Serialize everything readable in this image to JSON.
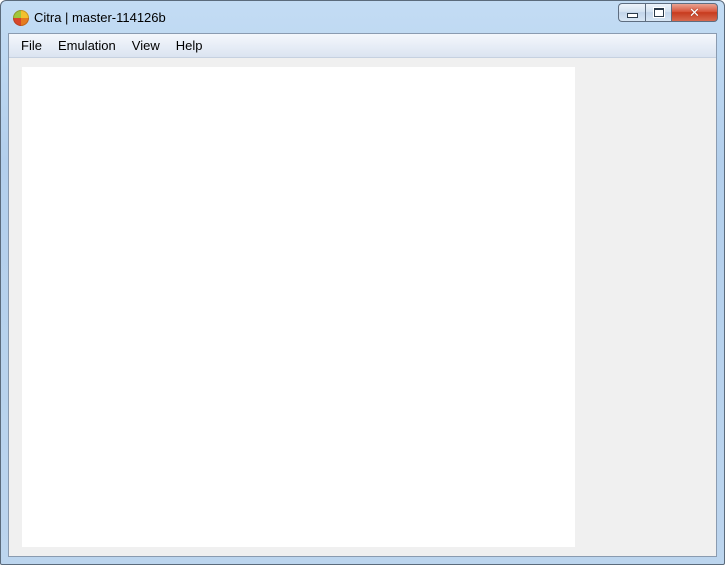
{
  "window": {
    "title": "Citra | master-114126b",
    "app_icon": "citra-logo-icon",
    "controls": {
      "minimize_icon": "minimize-icon",
      "maximize_icon": "maximize-icon",
      "close_icon": "close-icon",
      "close_glyph": "✕"
    }
  },
  "menubar": {
    "items": [
      {
        "label": "File"
      },
      {
        "label": "Emulation"
      },
      {
        "label": "View"
      },
      {
        "label": "Help"
      }
    ]
  },
  "colors": {
    "title_bar": "#c3dcf4",
    "client_background": "#f0f0f0",
    "render_background": "#ffffff",
    "close_button": "#c73b1e"
  }
}
